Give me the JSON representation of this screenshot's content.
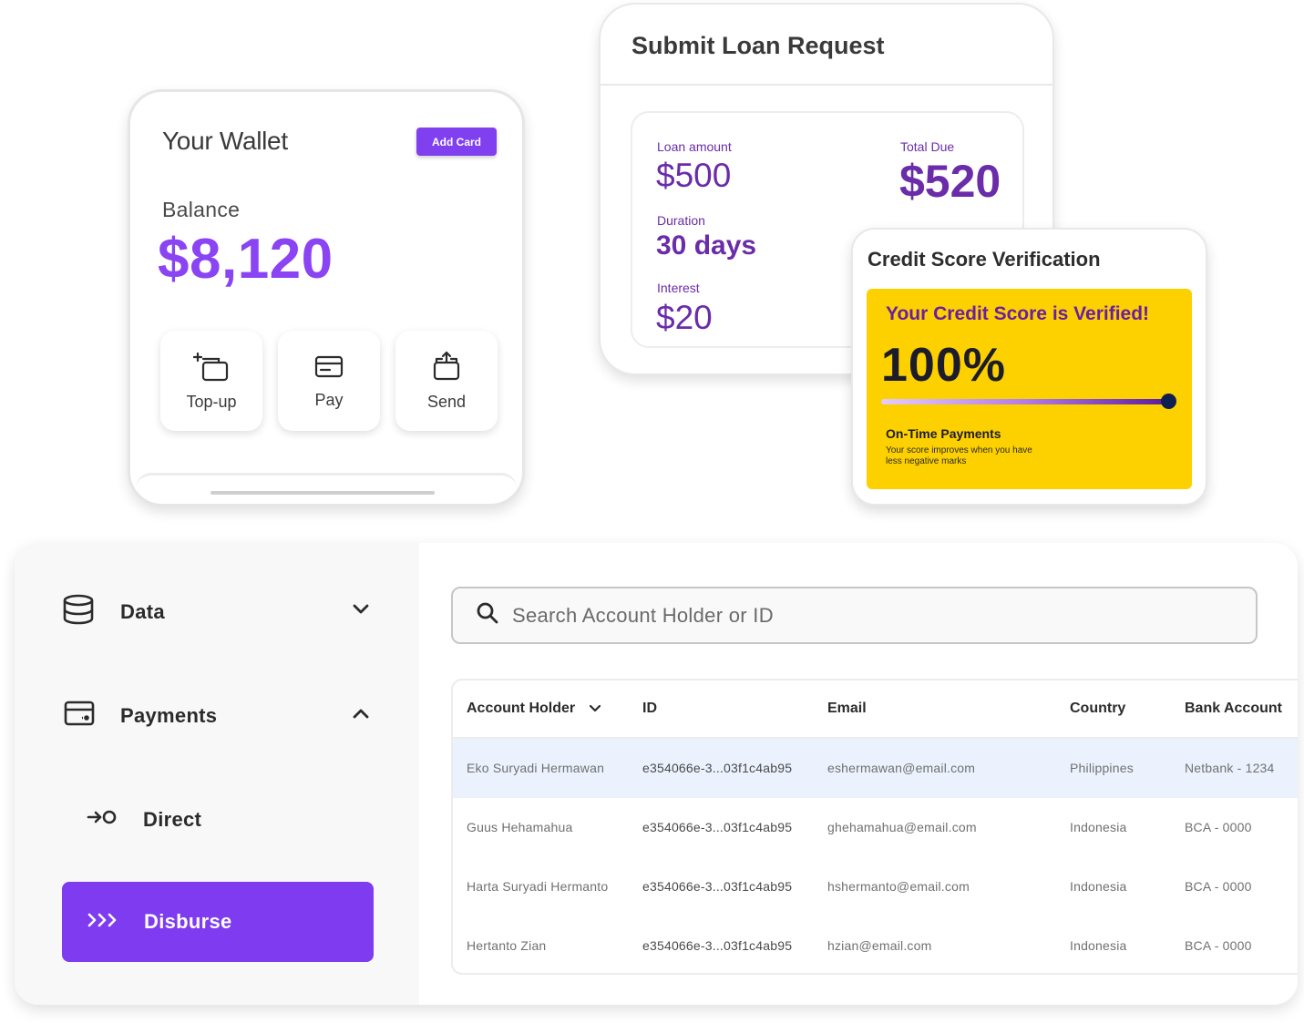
{
  "wallet": {
    "title": "Your Wallet",
    "add_card": "Add Card",
    "balance_label": "Balance",
    "balance_value": "$8,120",
    "actions": [
      {
        "label": "Top-up",
        "icon": "wallet-plus-icon"
      },
      {
        "label": "Pay",
        "icon": "card-icon"
      },
      {
        "label": "Send",
        "icon": "wallet-send-icon"
      }
    ]
  },
  "loan": {
    "title": "Submit Loan Request",
    "amount_label": "Loan amount",
    "amount_value": "$500",
    "total_label": "Total Due",
    "total_value": "$520",
    "duration_label": "Duration",
    "duration_value": "30 days",
    "interest_label": "Interest",
    "interest_value": "$20"
  },
  "credit": {
    "title": "Credit Score Verification",
    "verified": "Your Credit Score is Verified!",
    "percent": "100%",
    "progress": 1.0,
    "ontime_title": "On-Time Payments",
    "ontime_sub": "Your score improves when you have less negative marks"
  },
  "sidebar": {
    "data_label": "Data",
    "payments_label": "Payments",
    "direct_label": "Direct",
    "disburse_label": "Disburse"
  },
  "search": {
    "placeholder": "Search Account Holder or ID"
  },
  "table": {
    "headers": [
      "Account Holder",
      "ID",
      "Email",
      "Country",
      "Bank Account"
    ],
    "rows": [
      [
        "Eko Suryadi Hermawan",
        "e354066e-3...03f1c4ab95",
        "eshermawan@email.com",
        "Philippines",
        "Netbank - 1234"
      ],
      [
        "Guus Hehamahua",
        "e354066e-3...03f1c4ab95",
        "ghehamahua@email.com",
        "Indonesia",
        "BCA - 0000"
      ],
      [
        "Harta Suryadi Hermanto",
        "e354066e-3...03f1c4ab95",
        "hshermanto@email.com",
        "Indonesia",
        "BCA - 0000"
      ],
      [
        "Hertanto Zian",
        "e354066e-3...03f1c4ab95",
        "hzian@email.com",
        "Indonesia",
        "BCA - 0000"
      ]
    ]
  },
  "colors": {
    "accent_purple": "#7e3bef",
    "balance_purple": "#8a44f3",
    "loan_purple": "#6a2ca8",
    "credit_yellow": "#fdd000",
    "selected_row": "#ebf2fd"
  }
}
